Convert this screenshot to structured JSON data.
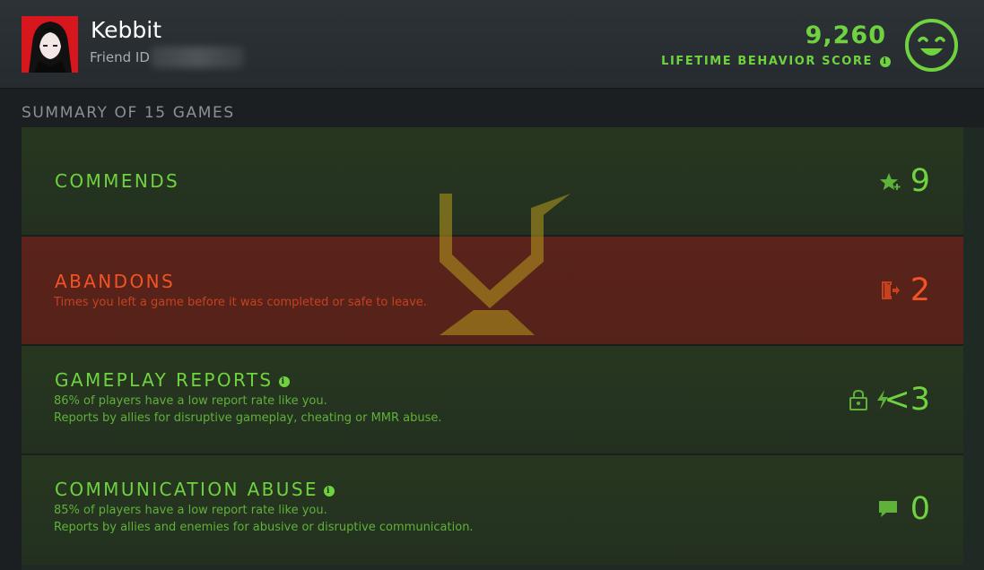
{
  "player": {
    "name": "Kebbit",
    "friend_id_label": "Friend ID"
  },
  "behavior": {
    "score": "9,260",
    "label": "LIFETIME BEHAVIOR SCORE",
    "info_icon": "info-icon",
    "mood_icon": "smiley-face-icon"
  },
  "summary": {
    "title": "SUMMARY OF 15 GAMES"
  },
  "rows": {
    "commends": {
      "title": "COMMENDS",
      "value": "9",
      "icon": "star-plus-icon"
    },
    "abandons": {
      "title": "ABANDONS",
      "description": "Times you left a game before it was completed or safe to leave.",
      "value": "2",
      "icon": "exit-door-icon"
    },
    "gameplay_reports": {
      "title": "GAMEPLAY REPORTS",
      "line1": "86% of players have a low report rate like you.",
      "line2": "Reports by allies for disruptive gameplay, cheating or MMR abuse.",
      "value": "<3",
      "icons": [
        "lock-icon",
        "lightning-icon"
      ]
    },
    "communication_abuse": {
      "title": "COMMUNICATION ABUSE",
      "line1": "85% of players have a low report rate like you.",
      "line2": "Reports by allies and enemies for abusive or disruptive communication.",
      "value": "0",
      "icon": "chat-bubble-icon"
    }
  },
  "colors": {
    "positive": "#6fd33f",
    "negative": "#f15323",
    "emblem": "#b89a1e"
  }
}
